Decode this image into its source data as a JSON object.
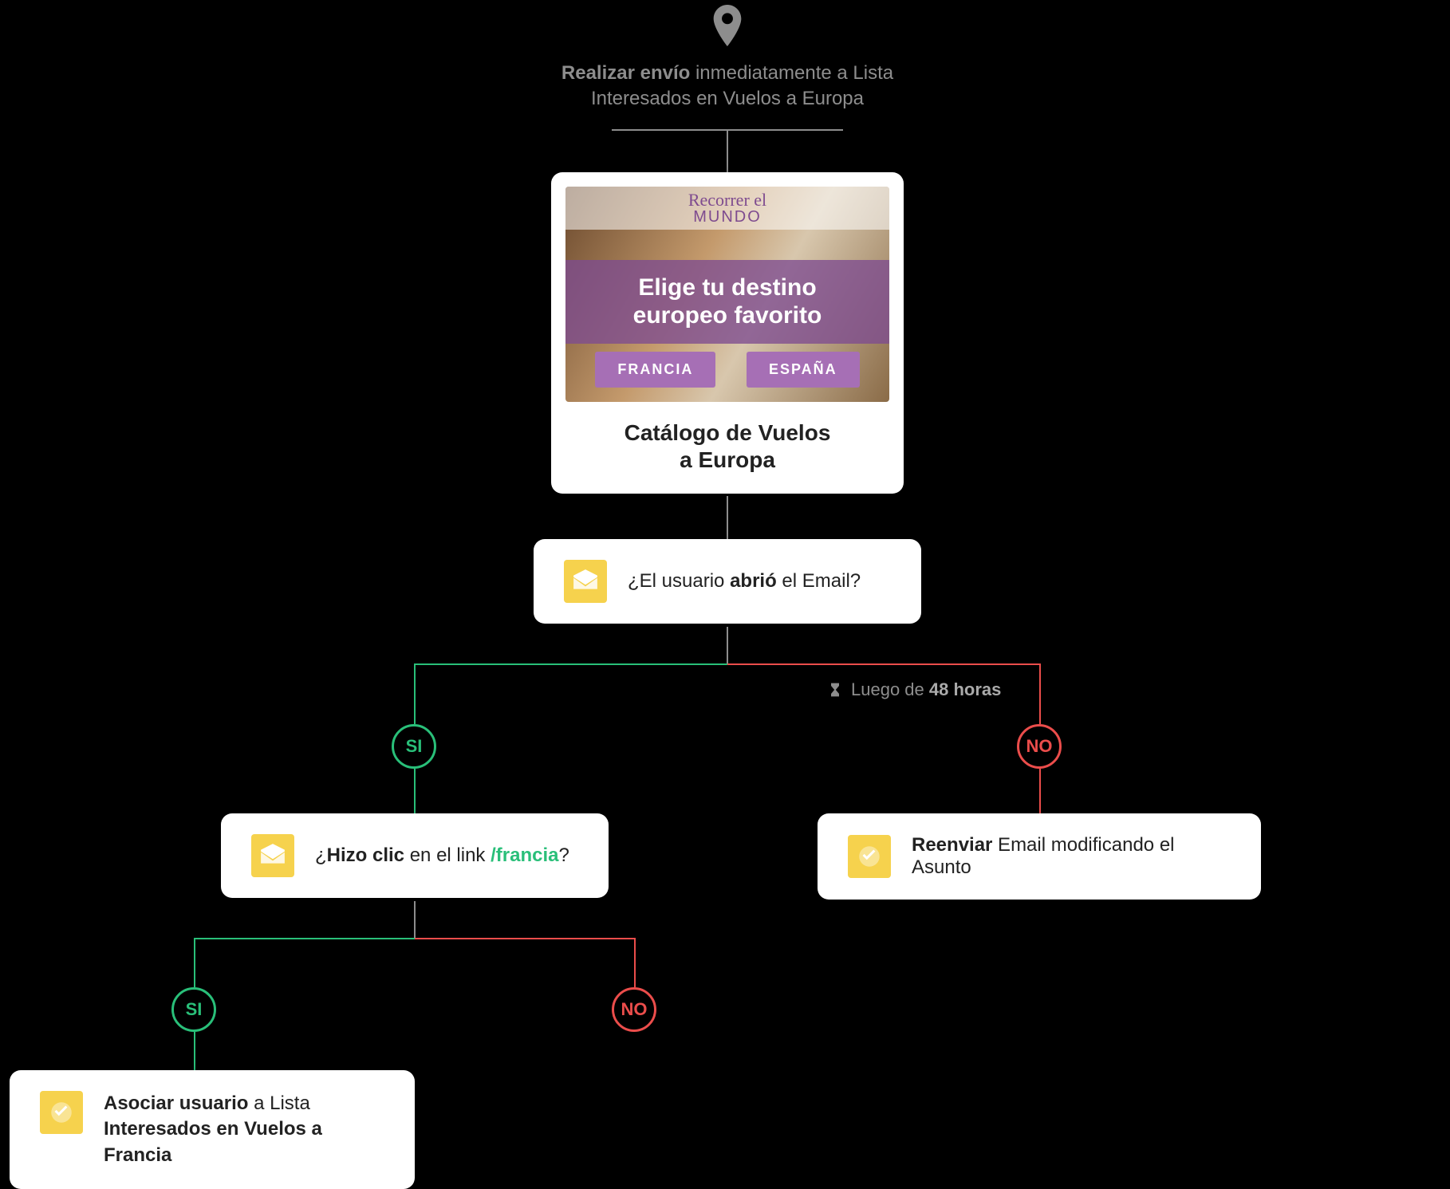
{
  "start": {
    "bold": "Realizar envío",
    "rest1": " inmediatamente a Lista",
    "line2": "Interesados en Vuelos a Europa"
  },
  "email": {
    "logo_line1": "Recorrer el",
    "logo_line2": "MUNDO",
    "headline_line1": "Elige tu destino",
    "headline_line2": "europeo favorito",
    "btn_left": "FRANCIA",
    "btn_right": "ESPAÑA",
    "caption_line1": "Catálogo de Vuelos",
    "caption_line2": "a Europa"
  },
  "decision1": {
    "prefix": "¿El usuario ",
    "bold": "abrió",
    "suffix": " el Email?"
  },
  "branch": {
    "si": "SI",
    "no": "NO"
  },
  "delay": {
    "prefix": "Luego de ",
    "bold": "48 horas"
  },
  "decision2": {
    "prefix": "¿",
    "bold": "Hizo clic",
    "mid": " en el link ",
    "link": "/francia",
    "suffix": "?"
  },
  "actionResend": {
    "bold": "Reenviar",
    "rest": " Email modificando el Asunto"
  },
  "actionAssociate": {
    "bold1": "Asociar usuario",
    "rest1": " a Lista",
    "line2": "Interesados en Vuelos a Francia"
  }
}
